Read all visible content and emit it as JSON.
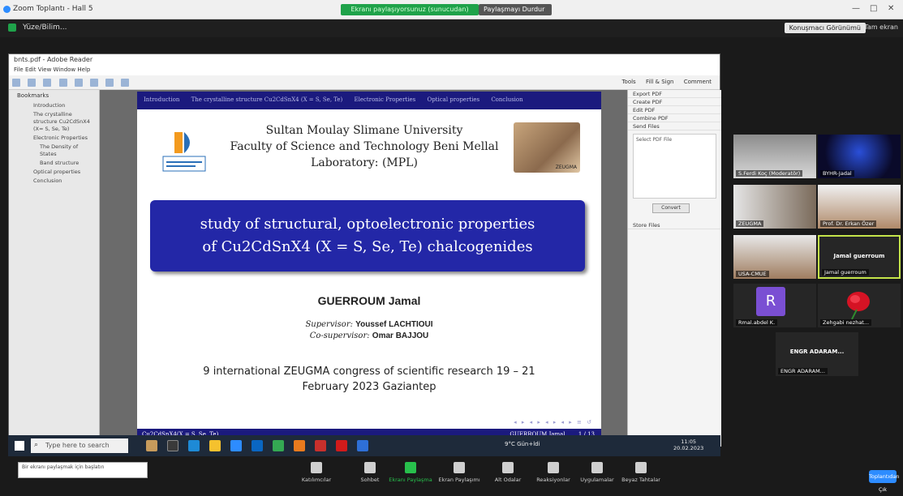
{
  "zoom": {
    "window_title": "Zoom Toplantı - Hall 5",
    "sharing_banner": "Ekranı paylaşıyorsunuz (sunucudan)",
    "stop_share_label": "Paylaşmayı Durdur",
    "meeting_name": "Yüze/Bilim...",
    "speaker_view_label": "Konuşmacı Görünümü",
    "fullscreen_label": "Tam ekran",
    "controls": [
      {
        "label": "Katılımcılar",
        "icon": "participants-icon"
      },
      {
        "label": "Sohbet",
        "icon": "chat-icon"
      },
      {
        "label": "Ekranı Paylaşma",
        "icon": "share-screen-icon"
      },
      {
        "label": "Ekran Paylaşımı",
        "icon": "share-options-icon"
      },
      {
        "label": "Alt Odalar",
        "icon": "rooms-icon"
      },
      {
        "label": "Reaksiyonlar",
        "icon": "reactions-icon"
      },
      {
        "label": "Uygulamalar",
        "icon": "apps-icon"
      },
      {
        "label": "Beyaz Tahtalar",
        "icon": "whiteboard-icon"
      }
    ],
    "end_label": "Toplantıdan Çık",
    "participants": [
      {
        "name": "S.Ferdi Koç (Moderatör)",
        "kind": "video"
      },
      {
        "name": "BYHR-Jadal",
        "kind": "video"
      },
      {
        "name": "ZEUGMA",
        "kind": "video"
      },
      {
        "name": "Prof. Dr. Erkan Özer",
        "kind": "video"
      },
      {
        "name": "USA-CMUE",
        "kind": "video"
      },
      {
        "name": "Jamal guerroum",
        "kind": "name",
        "active": true
      },
      {
        "name": "Rmal.abdel K.",
        "kind": "avatar",
        "initial": "R"
      },
      {
        "name": "Zehgabi nezhat...",
        "kind": "rose"
      },
      {
        "name": "ENGR ADARAM...",
        "kind": "name"
      }
    ]
  },
  "acrobat": {
    "title": "bnts.pdf - Adobe Reader",
    "menu": "File  Edit  View  Window  Help",
    "toolbar_links": [
      "Tools",
      "Fill & Sign",
      "Comment"
    ],
    "bookmarks_title": "Bookmarks",
    "bookmarks": [
      "Introduction",
      "The crystalline structure Cu2CdSnX4 (X= S, Se, Te)",
      "Electronic Properties",
      "The Density of States",
      "Band structure",
      "Optical properties",
      "Conclusion"
    ],
    "right_pane": [
      "Export PDF",
      "Create PDF",
      "Edit PDF",
      "Combine PDF",
      "Send Files"
    ],
    "right_pane_box": "Select PDF File",
    "right_pane_button": "Convert",
    "right_pane_footer": "Store Files"
  },
  "slide": {
    "nav": [
      "Introduction",
      "The crystalline structure Cu2CdSnX4 (X = S, Se, Te)",
      "Electronic Properties",
      "Optical properties",
      "Conclusion"
    ],
    "institution": [
      "Sultan Moulay Slimane University",
      "Faculty of Science and Technology Beni Mellal",
      "Laboratory: (MPL)"
    ],
    "sponsor_label": "ZEUGMA",
    "title_line1": "study of structural, optoelectronic properties",
    "title_line2": "of Cu2CdSnX4 (X = S, Se, Te) chalcogenides",
    "author": "GUERROUM Jamal",
    "supervisor_prefix": "Supervisor:",
    "supervisor": "Youssef LACHTIOUI",
    "cosupervisor_prefix": "Co-supervisor:",
    "cosupervisor": "Omar BAJJOU",
    "conference_line1": "9 international ZEUGMA congress of scientific research 19 – 21",
    "conference_line2": "February 2023 Gaziantep",
    "footer_left": "Cu2CdSnX4(X = S, Se, Te)",
    "footer_author": "GUERROUM Jamal",
    "footer_page": "1 / 13",
    "beamer_nav": "◂ ▸ ◂ ▸ ◂ ▸ ◂ ▸ ≡ ↺"
  },
  "windows": {
    "search_placeholder": "Type here to search",
    "weather": "9°C Gün+ldi",
    "clock_time": "11:05",
    "clock_date": "20.02.2023",
    "tooltip": "Bir ekranı paylaşmak için başlatın"
  }
}
